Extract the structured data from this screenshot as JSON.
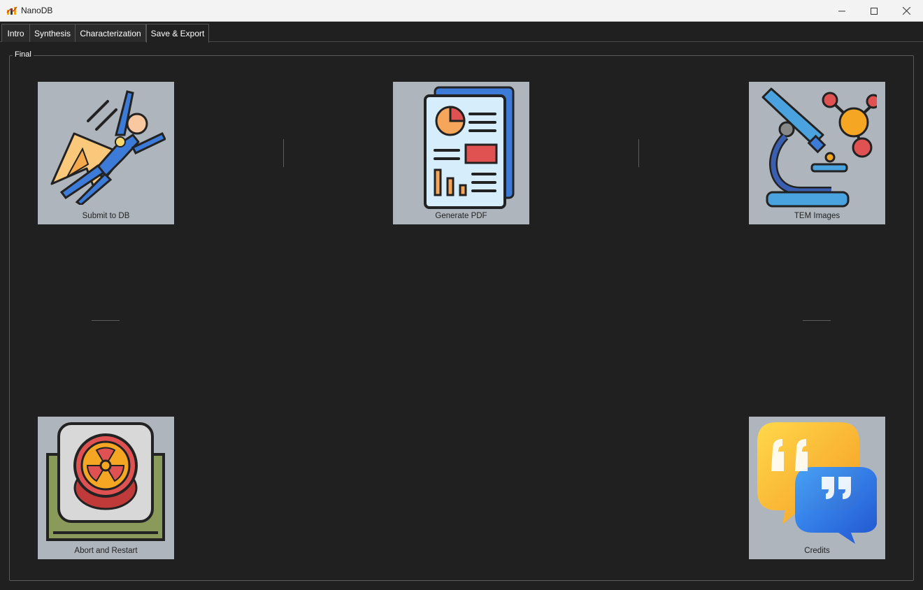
{
  "window": {
    "title": "NanoDB",
    "icon": "nanodb-logo-icon",
    "controls": [
      "minimize-icon",
      "maximize-icon",
      "close-icon"
    ]
  },
  "tabs": [
    {
      "label": "Intro",
      "active": false
    },
    {
      "label": "Synthesis",
      "active": false
    },
    {
      "label": "Characterization",
      "active": false
    },
    {
      "label": "Save & Export",
      "active": true
    }
  ],
  "group": {
    "title": "Final"
  },
  "buttons": {
    "submit": {
      "label": "Submit to DB",
      "icon": "superhero-flying-icon"
    },
    "pdf": {
      "label": "Generate PDF",
      "icon": "report-document-icon"
    },
    "tem": {
      "label": "TEM Images",
      "icon": "microscope-molecule-icon"
    },
    "abort": {
      "label": "Abort and Restart",
      "icon": "radiation-button-icon"
    },
    "credits": {
      "label": "Credits",
      "icon": "speech-bubbles-quotes-icon"
    }
  },
  "colors": {
    "background": "#202020",
    "tile": "#aeb5bd",
    "titlebar": "#f3f3f3"
  }
}
